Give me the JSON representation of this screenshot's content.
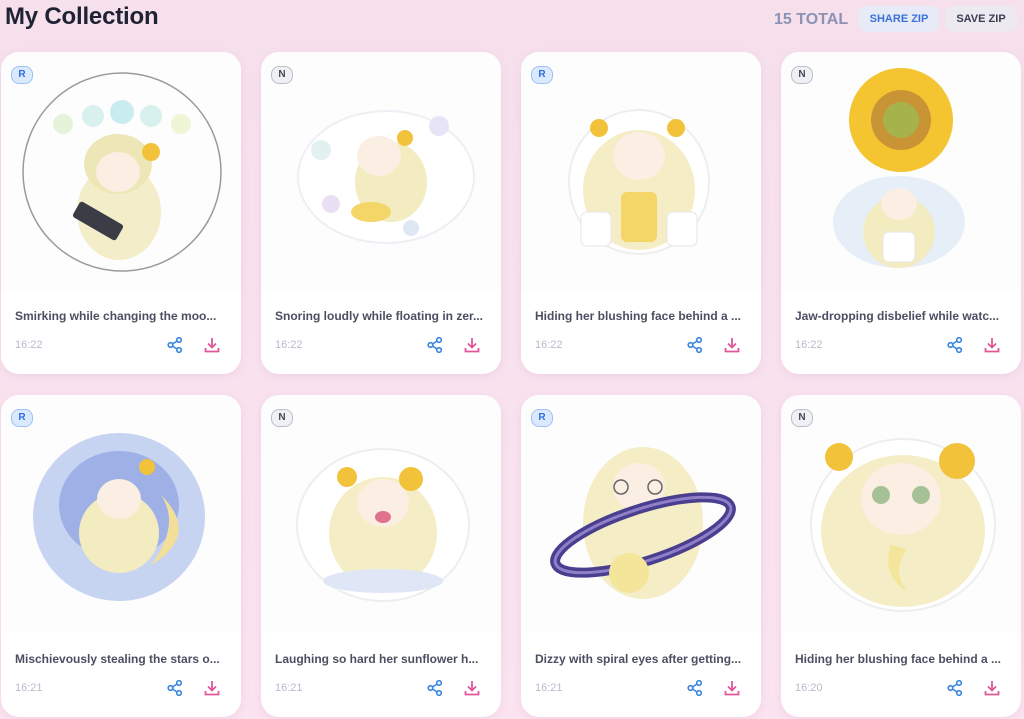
{
  "header": {
    "title": "My Collection",
    "total": "15 TOTAL",
    "share_zip": "SHARE ZIP",
    "save_zip": "SAVE ZIP"
  },
  "colors": {
    "accent_blue": "#3b71d8",
    "download_pink": "#e0569a",
    "share_blue": "#3a86e0",
    "background": "#f8e1ef"
  },
  "cards": [
    {
      "badge": "R",
      "caption": "Smirking while changing the moo...",
      "time": "16:22",
      "share_icon": "share-icon",
      "download_icon": "download-icon"
    },
    {
      "badge": "N",
      "caption": "Snoring loudly while floating in zer...",
      "time": "16:22",
      "share_icon": "share-icon",
      "download_icon": "download-icon"
    },
    {
      "badge": "R",
      "caption": "Hiding her blushing face behind a ...",
      "time": "16:22",
      "share_icon": "share-icon",
      "download_icon": "download-icon"
    },
    {
      "badge": "N",
      "caption": "Jaw-dropping disbelief while watc...",
      "time": "16:22",
      "share_icon": "share-icon",
      "download_icon": "download-icon"
    },
    {
      "badge": "R",
      "caption": "Mischievously stealing the stars o...",
      "time": "16:21",
      "share_icon": "share-icon",
      "download_icon": "download-icon"
    },
    {
      "badge": "N",
      "caption": "Laughing so hard her sunflower h...",
      "time": "16:21",
      "share_icon": "share-icon",
      "download_icon": "download-icon"
    },
    {
      "badge": "R",
      "caption": "Dizzy with spiral eyes after getting...",
      "time": "16:21",
      "share_icon": "share-icon",
      "download_icon": "download-icon"
    },
    {
      "badge": "N",
      "caption": "Hiding her blushing face behind a ...",
      "time": "16:20",
      "share_icon": "share-icon",
      "download_icon": "download-icon"
    }
  ]
}
